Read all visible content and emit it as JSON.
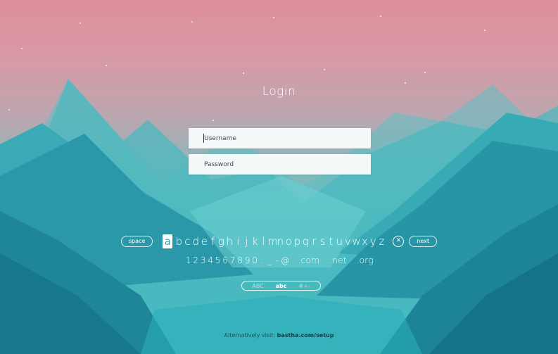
{
  "login": {
    "title": "Login",
    "username_placeholder": "Username",
    "password_placeholder": "Password"
  },
  "keyboard": {
    "space_label": "space",
    "next_label": "next",
    "clear_icon": "close-circle-icon",
    "letters": [
      "a",
      "b",
      "c",
      "d",
      "e",
      "f",
      "g",
      "h",
      "i",
      "j",
      "k",
      "l",
      "m",
      "n",
      "o",
      "p",
      "q",
      "r",
      "s",
      "t",
      "u",
      "v",
      "w",
      "x",
      "y",
      "z"
    ],
    "selected_letter": "a",
    "symbols": [
      "1",
      "2",
      "3",
      "4",
      "5",
      "6",
      "7",
      "8",
      "9",
      "0",
      ".",
      "_",
      "-",
      "@"
    ],
    "domains": [
      ".com",
      ".net",
      ".org"
    ]
  },
  "mode_switch": {
    "options": [
      "ABC",
      "abc",
      "#+-"
    ],
    "active": "abc"
  },
  "footer": {
    "prefix": "Alternatively visit:",
    "link": "bastha.com/setup"
  },
  "colors": {
    "sky_top": "#e08e9c",
    "sky_mid": "#b9a7b0",
    "teal": "#3cb9c2",
    "teal_dark": "#167e92"
  }
}
